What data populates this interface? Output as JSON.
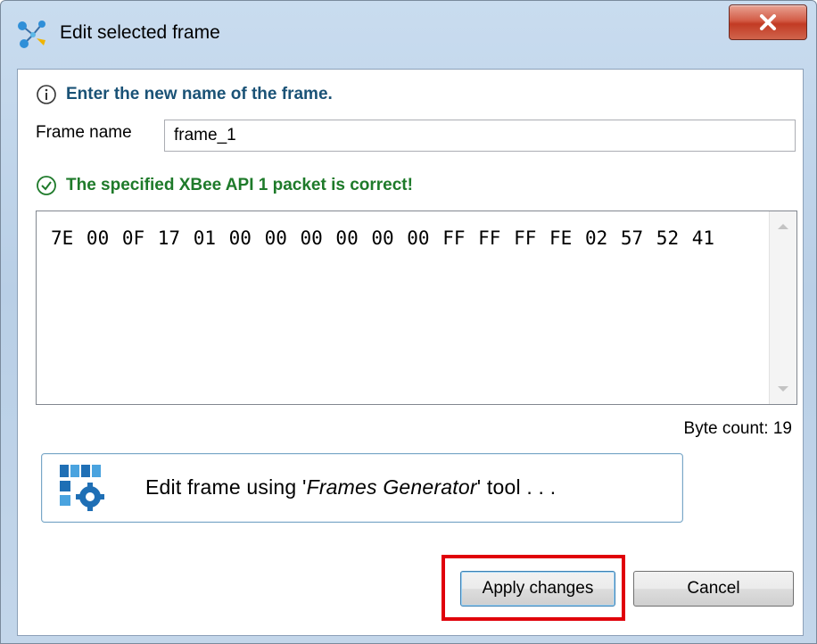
{
  "window": {
    "title": "Edit selected frame",
    "close_glyph": "X"
  },
  "info": {
    "icon": "info-icon",
    "message": "Enter the new name of the frame."
  },
  "frame_name": {
    "label": "Frame name",
    "value": "frame_1"
  },
  "validation": {
    "icon": "check-circle-icon",
    "message": "The specified XBee API 1 packet is correct!",
    "color": "#1e7a2a"
  },
  "packet": {
    "hex": "7E 00 0F 17 01 00 00 00 00 00 00 FF FF FF FE 02 57 52 41"
  },
  "byte_count": "Byte count: 19",
  "generator": {
    "prefix": "Edit frame using '",
    "tool_name": "Frames Generator",
    "suffix": "' tool . . ."
  },
  "buttons": {
    "apply": "Apply changes",
    "cancel": "Cancel"
  },
  "colors": {
    "info_text": "#1a5276",
    "highlight": "#e0000a",
    "close_button": "#c23b24"
  }
}
